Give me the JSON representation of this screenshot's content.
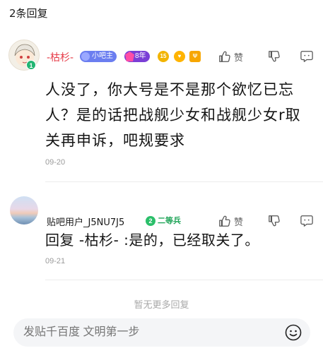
{
  "header": {
    "reply_count": "2条回复"
  },
  "posts": [
    {
      "username": "-枯杉-",
      "avatar_level": "1",
      "badges": {
        "bar_role": "小吧主",
        "years": "8年",
        "medal_1": "15",
        "medal_2": "♥",
        "medal_3": "Ψ"
      },
      "content": "人没了，你大号是不是那个欲忆已忘人？是的话把战舰少女和战舰少女r取关再申诉，吧规要求",
      "date": "09-20",
      "actions": {
        "like_label": "赞"
      }
    },
    {
      "username": "贴吧用户_J5NU7J5",
      "rank": {
        "level": "2",
        "title": "二等兵"
      },
      "content": "回复 -枯杉- :是的，已经取关了。",
      "date": "09-21",
      "actions": {
        "like_label": "赞"
      }
    }
  ],
  "footer": {
    "no_more": "暂无更多回复"
  },
  "reply_bar": {
    "placeholder": "发贴千百度 文明第一步"
  },
  "icons": {
    "like": "thumbs-up-icon",
    "dislike": "thumbs-down-icon",
    "reply": "comment-icon",
    "emoji": "smiley-face-icon"
  },
  "colors": {
    "username_highlight": "#e63946",
    "rank_green": "#22a55a",
    "bar_admin": "#6b7ef0"
  }
}
